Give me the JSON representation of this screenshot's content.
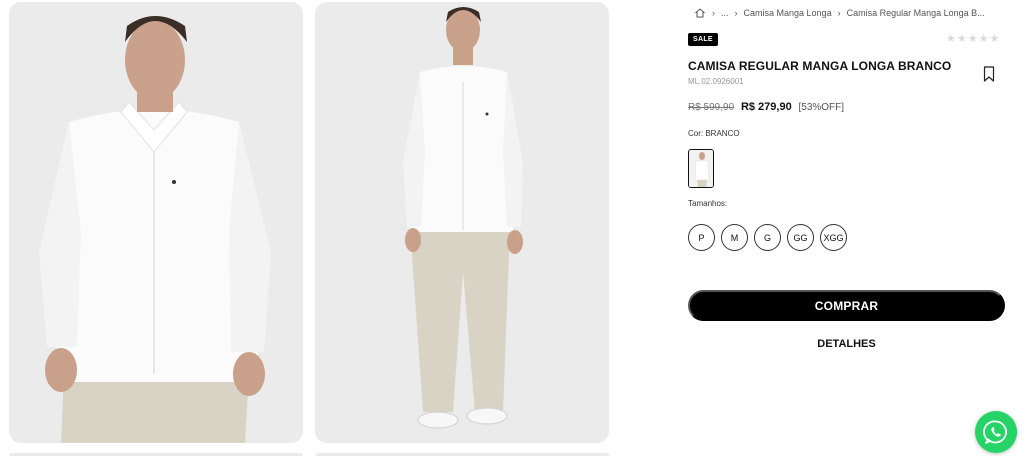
{
  "breadcrumb": {
    "home_icon": "home-icon",
    "ellipsis": "...",
    "category": "Camisa Manga Longa",
    "current": "Camisa Regular Manga Longa B..."
  },
  "product": {
    "badge": "SALE",
    "name": "CAMISA REGULAR MANGA LONGA BRANCO",
    "sku": "ML.02.0926001",
    "rating_stars": 0,
    "old_price": "R$ 599,90",
    "price": "R$ 279,90",
    "discount": "[53%OFF]",
    "color_label": "Cor: BRANCO",
    "sizes_label": "Tamanhos:",
    "sizes": [
      "P",
      "M",
      "G",
      "GG",
      "XGG"
    ],
    "buy_label": "COMPRAR",
    "details_label": "DETALHES"
  },
  "colors": {
    "background": "#ffffff",
    "image_bg": "#ebebeb",
    "primary_button": "#000000",
    "whatsapp": "#25d366"
  }
}
